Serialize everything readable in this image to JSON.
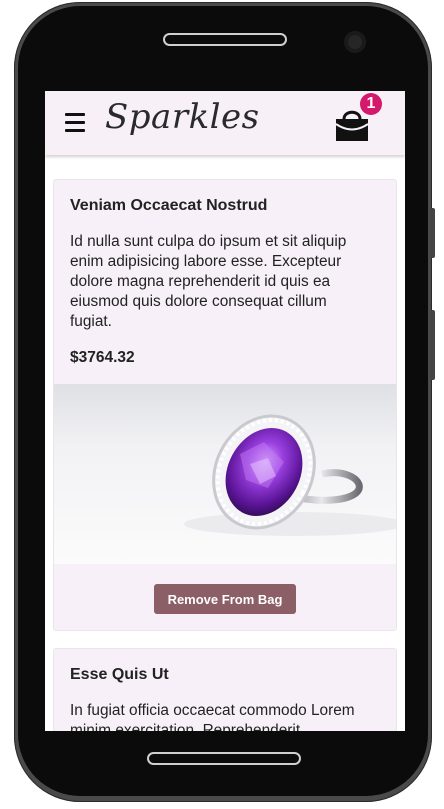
{
  "header": {
    "logo_text": "Sparkles",
    "cart_count": "1"
  },
  "products": [
    {
      "title": "Veniam Occaecat Nostrud",
      "description": "Id nulla sunt culpa do ipsum et sit aliquip enim adipisicing labore esse. Excepteur dolore magna reprehenderit id quis ea eiusmod quis dolore consequat cillum fugiat.",
      "price": "$3764.32",
      "action_label": "Remove From Bag",
      "image": "amethyst-ring"
    },
    {
      "title": "Esse Quis Ut",
      "description": "In fugiat officia occaecat commodo Lorem minim exercitation. Reprehenderit"
    }
  ],
  "colors": {
    "header_bg": "#f7f0f7",
    "card_bg": "#f7f0f8",
    "badge": "#d4186c",
    "button": "#8c5e66"
  }
}
